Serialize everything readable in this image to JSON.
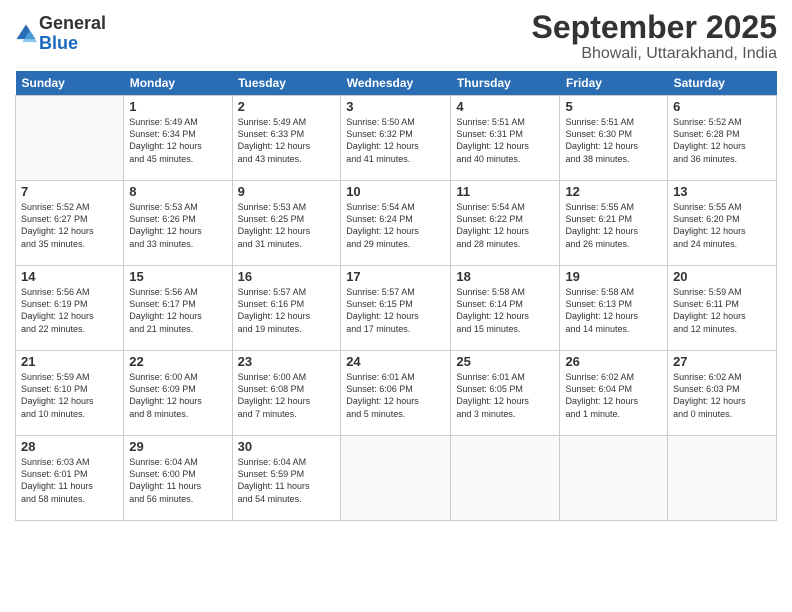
{
  "header": {
    "logo_general": "General",
    "logo_blue": "Blue",
    "month": "September 2025",
    "location": "Bhowali, Uttarakhand, India"
  },
  "days": [
    "Sunday",
    "Monday",
    "Tuesday",
    "Wednesday",
    "Thursday",
    "Friday",
    "Saturday"
  ],
  "weeks": [
    [
      {
        "day": "",
        "info": ""
      },
      {
        "day": "1",
        "info": "Sunrise: 5:49 AM\nSunset: 6:34 PM\nDaylight: 12 hours\nand 45 minutes."
      },
      {
        "day": "2",
        "info": "Sunrise: 5:49 AM\nSunset: 6:33 PM\nDaylight: 12 hours\nand 43 minutes."
      },
      {
        "day": "3",
        "info": "Sunrise: 5:50 AM\nSunset: 6:32 PM\nDaylight: 12 hours\nand 41 minutes."
      },
      {
        "day": "4",
        "info": "Sunrise: 5:51 AM\nSunset: 6:31 PM\nDaylight: 12 hours\nand 40 minutes."
      },
      {
        "day": "5",
        "info": "Sunrise: 5:51 AM\nSunset: 6:30 PM\nDaylight: 12 hours\nand 38 minutes."
      },
      {
        "day": "6",
        "info": "Sunrise: 5:52 AM\nSunset: 6:28 PM\nDaylight: 12 hours\nand 36 minutes."
      }
    ],
    [
      {
        "day": "7",
        "info": "Sunrise: 5:52 AM\nSunset: 6:27 PM\nDaylight: 12 hours\nand 35 minutes."
      },
      {
        "day": "8",
        "info": "Sunrise: 5:53 AM\nSunset: 6:26 PM\nDaylight: 12 hours\nand 33 minutes."
      },
      {
        "day": "9",
        "info": "Sunrise: 5:53 AM\nSunset: 6:25 PM\nDaylight: 12 hours\nand 31 minutes."
      },
      {
        "day": "10",
        "info": "Sunrise: 5:54 AM\nSunset: 6:24 PM\nDaylight: 12 hours\nand 29 minutes."
      },
      {
        "day": "11",
        "info": "Sunrise: 5:54 AM\nSunset: 6:22 PM\nDaylight: 12 hours\nand 28 minutes."
      },
      {
        "day": "12",
        "info": "Sunrise: 5:55 AM\nSunset: 6:21 PM\nDaylight: 12 hours\nand 26 minutes."
      },
      {
        "day": "13",
        "info": "Sunrise: 5:55 AM\nSunset: 6:20 PM\nDaylight: 12 hours\nand 24 minutes."
      }
    ],
    [
      {
        "day": "14",
        "info": "Sunrise: 5:56 AM\nSunset: 6:19 PM\nDaylight: 12 hours\nand 22 minutes."
      },
      {
        "day": "15",
        "info": "Sunrise: 5:56 AM\nSunset: 6:17 PM\nDaylight: 12 hours\nand 21 minutes."
      },
      {
        "day": "16",
        "info": "Sunrise: 5:57 AM\nSunset: 6:16 PM\nDaylight: 12 hours\nand 19 minutes."
      },
      {
        "day": "17",
        "info": "Sunrise: 5:57 AM\nSunset: 6:15 PM\nDaylight: 12 hours\nand 17 minutes."
      },
      {
        "day": "18",
        "info": "Sunrise: 5:58 AM\nSunset: 6:14 PM\nDaylight: 12 hours\nand 15 minutes."
      },
      {
        "day": "19",
        "info": "Sunrise: 5:58 AM\nSunset: 6:13 PM\nDaylight: 12 hours\nand 14 minutes."
      },
      {
        "day": "20",
        "info": "Sunrise: 5:59 AM\nSunset: 6:11 PM\nDaylight: 12 hours\nand 12 minutes."
      }
    ],
    [
      {
        "day": "21",
        "info": "Sunrise: 5:59 AM\nSunset: 6:10 PM\nDaylight: 12 hours\nand 10 minutes."
      },
      {
        "day": "22",
        "info": "Sunrise: 6:00 AM\nSunset: 6:09 PM\nDaylight: 12 hours\nand 8 minutes."
      },
      {
        "day": "23",
        "info": "Sunrise: 6:00 AM\nSunset: 6:08 PM\nDaylight: 12 hours\nand 7 minutes."
      },
      {
        "day": "24",
        "info": "Sunrise: 6:01 AM\nSunset: 6:06 PM\nDaylight: 12 hours\nand 5 minutes."
      },
      {
        "day": "25",
        "info": "Sunrise: 6:01 AM\nSunset: 6:05 PM\nDaylight: 12 hours\nand 3 minutes."
      },
      {
        "day": "26",
        "info": "Sunrise: 6:02 AM\nSunset: 6:04 PM\nDaylight: 12 hours\nand 1 minute."
      },
      {
        "day": "27",
        "info": "Sunrise: 6:02 AM\nSunset: 6:03 PM\nDaylight: 12 hours\nand 0 minutes."
      }
    ],
    [
      {
        "day": "28",
        "info": "Sunrise: 6:03 AM\nSunset: 6:01 PM\nDaylight: 11 hours\nand 58 minutes."
      },
      {
        "day": "29",
        "info": "Sunrise: 6:04 AM\nSunset: 6:00 PM\nDaylight: 11 hours\nand 56 minutes."
      },
      {
        "day": "30",
        "info": "Sunrise: 6:04 AM\nSunset: 5:59 PM\nDaylight: 11 hours\nand 54 minutes."
      },
      {
        "day": "",
        "info": ""
      },
      {
        "day": "",
        "info": ""
      },
      {
        "day": "",
        "info": ""
      },
      {
        "day": "",
        "info": ""
      }
    ]
  ]
}
